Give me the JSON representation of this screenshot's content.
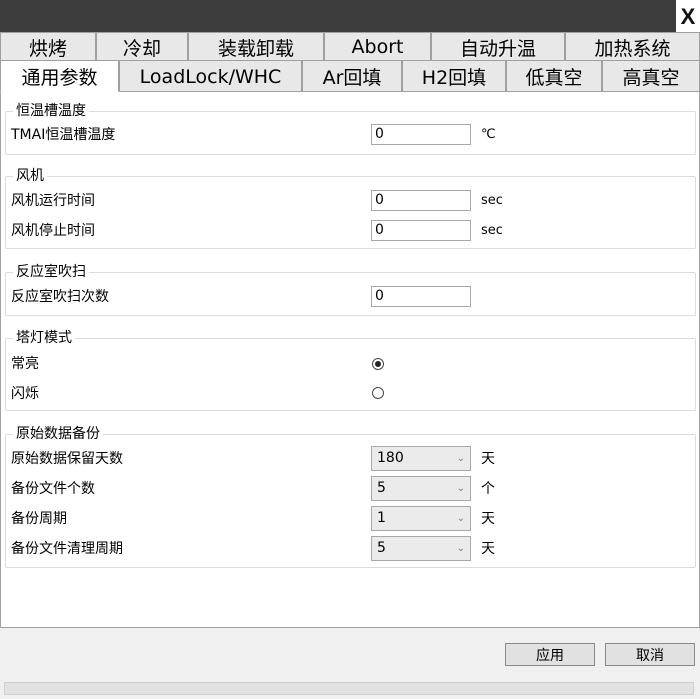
{
  "window": {
    "close_label": "X"
  },
  "tabs_row1": [
    "烘烤",
    "冷却",
    "装载卸载",
    "Abort",
    "自动升温",
    "加热系统"
  ],
  "tabs_row2": [
    "通用参数",
    "LoadLock/WHC",
    "Ar回填",
    "H2回填",
    "低真空",
    "高真空"
  ],
  "active_tab": "通用参数",
  "groups": {
    "thermostat": {
      "title": "恒温槽温度",
      "tmai_label": "TMAI恒温槽温度",
      "tmai_value": "0",
      "tmai_unit": "℃"
    },
    "fan": {
      "title": "风机",
      "run_label": "风机运行时间",
      "run_value": "0",
      "run_unit": "sec",
      "stop_label": "风机停止时间",
      "stop_value": "0",
      "stop_unit": "sec"
    },
    "purge": {
      "title": "反应室吹扫",
      "count_label": "反应室吹扫次数",
      "count_value": "0"
    },
    "tower_light": {
      "title": "塔灯模式",
      "option_on": "常亮",
      "option_blink": "闪烁",
      "selected": "常亮"
    },
    "backup": {
      "title": "原始数据备份",
      "keep_days_label": "原始数据保留天数",
      "keep_days_value": "180",
      "keep_days_unit": "天",
      "file_count_label": "备份文件个数",
      "file_count_value": "5",
      "file_count_unit": "个",
      "period_label": "备份周期",
      "period_value": "1",
      "period_unit": "天",
      "cleanup_label": "备份文件清理周期",
      "cleanup_value": "5",
      "cleanup_unit": "天"
    }
  },
  "buttons": {
    "apply": "应用",
    "cancel": "取消"
  },
  "icons": {
    "dropdown": "chevron-down-icon"
  }
}
